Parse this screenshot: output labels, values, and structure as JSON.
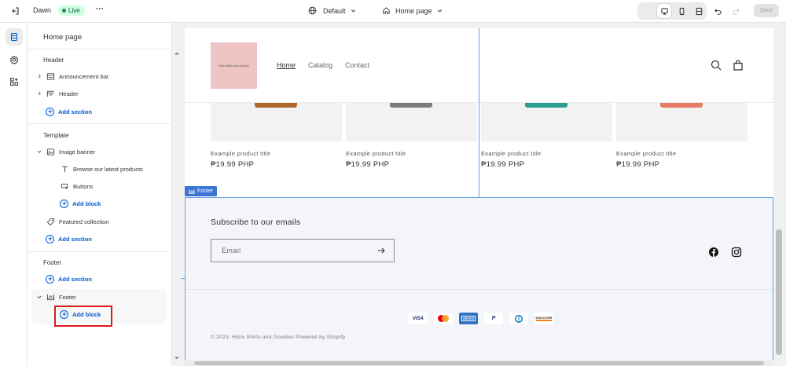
{
  "topbar": {
    "theme_name": "Dawn",
    "status": "Live",
    "more": "···",
    "template": "Default",
    "page": "Home page",
    "save_label": "Save"
  },
  "sidebar": {
    "title": "Home page",
    "groups": {
      "header": "Header",
      "template": "Template",
      "footer": "Footer"
    },
    "items": {
      "announcement_bar": "Announcement bar",
      "header": "Header",
      "add_section": "Add section",
      "image_banner": "Image banner",
      "browse": "Browse our latest products",
      "buttons": "Buttons",
      "add_block": "Add block",
      "featured_collection": "Featured collection",
      "footer": "Footer"
    }
  },
  "preview": {
    "logo_text": "Hello Shirts and Goodies",
    "nav": [
      "Home",
      "Catalog",
      "Contact"
    ],
    "products": [
      {
        "title": "Example product title",
        "price": "₱19.99 PHP",
        "color": "#b0672a"
      },
      {
        "title": "Example product title",
        "price": "₱19.99 PHP",
        "color": "#7a7d80"
      },
      {
        "title": "Example product title",
        "price": "₱19.99 PHP",
        "color": "#2a9d93"
      },
      {
        "title": "Example product title",
        "price": "₱19.99 PHP",
        "color": "#e77a63"
      }
    ],
    "footer_tag": "Footer",
    "subscribe_heading": "Subscribe to our emails",
    "email_placeholder": "Email",
    "payments": [
      "VISA",
      "Mastercard",
      "AMEX",
      "PayPal",
      "Diners",
      "DISCOVER"
    ],
    "copyright": "© 2023, Hello Shirts and Goodies Powered by Shopify"
  },
  "colors": {
    "accent": "#005bd3",
    "highlight_red": "#e01919",
    "selection_blue": "#3b74d4"
  }
}
